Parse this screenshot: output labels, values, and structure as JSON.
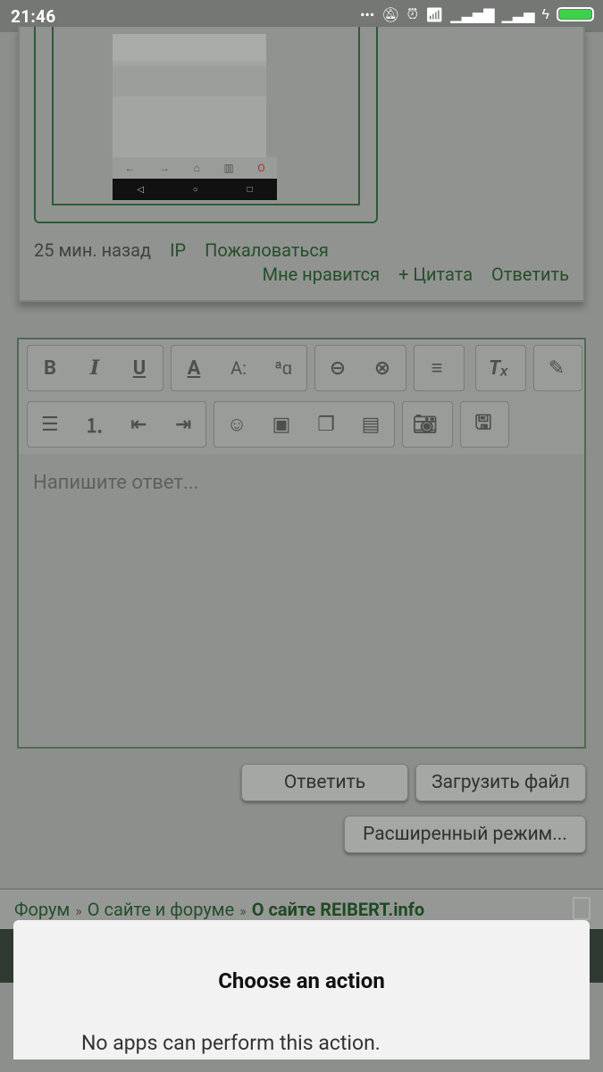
{
  "status": {
    "time": "21:46"
  },
  "post": {
    "meta": {
      "time_ago": "25 мин. назад",
      "ip": "IP",
      "report": "Пожаловаться"
    },
    "actions": {
      "like": "Мне нравится",
      "quote": "+ Цитата",
      "reply": "Ответить"
    }
  },
  "editor": {
    "placeholder": "Напишите ответ...",
    "toolbar": {
      "bold": "B",
      "italic": "I",
      "underline": "U",
      "font_color": "A",
      "font_size": "A:",
      "font_family": "ªɑ",
      "link": "⊖",
      "unlink": "⊗",
      "align": "≡",
      "remove_format": "Tₓ",
      "save_draft": "🖫"
    }
  },
  "buttons": {
    "reply": "Ответить",
    "upload": "Загрузить файл",
    "advanced": "Расширенный режим..."
  },
  "breadcrumb": {
    "forum": "Форум",
    "section": "О сайте и форуме",
    "current": "О сайте REIBERT.info",
    "sep": "»"
  },
  "dialog": {
    "title": "Choose an action",
    "message": "No apps can perform this action."
  }
}
